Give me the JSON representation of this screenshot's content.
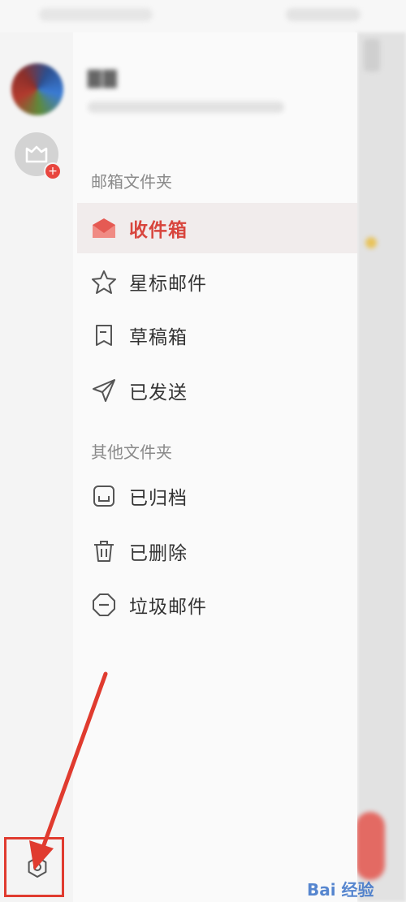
{
  "drawer": {
    "mailbox_section_title": "邮箱文件夹",
    "other_section_title": "其他文件夹",
    "folders": [
      {
        "label": "收件箱",
        "icon": "inbox-icon",
        "active": true
      },
      {
        "label": "星标邮件",
        "icon": "star-icon",
        "active": false
      },
      {
        "label": "草稿箱",
        "icon": "draft-icon",
        "active": false
      },
      {
        "label": "已发送",
        "icon": "send-icon",
        "active": false
      }
    ],
    "other_folders": [
      {
        "label": "已归档",
        "icon": "archive-icon"
      },
      {
        "label": "已删除",
        "icon": "trash-icon"
      },
      {
        "label": "垃圾邮件",
        "icon": "spam-icon"
      }
    ]
  },
  "rail": {
    "add_badge": "+",
    "settings_icon": "settings-icon"
  },
  "colors": {
    "accent": "#d8453d",
    "highlight": "#e03b2f"
  },
  "watermark": "Bai 经验"
}
